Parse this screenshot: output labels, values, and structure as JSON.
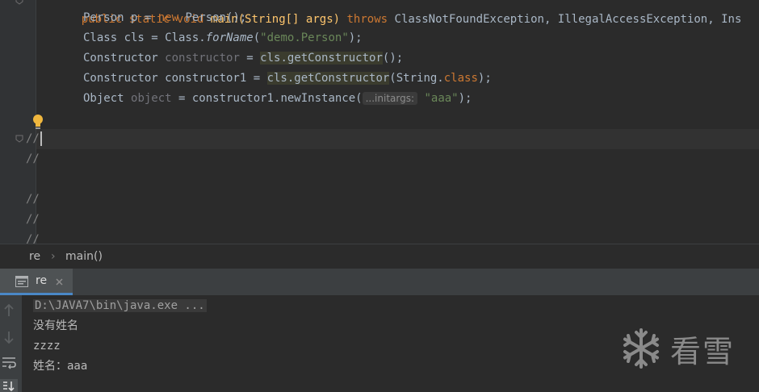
{
  "editor": {
    "header_line": {
      "mod1": "public",
      "mod2": "static",
      "mod3": "void",
      "method": "main(String[] args)",
      "throws_kw": "throws",
      "exceptions": "ClassNotFoundException, IllegalAccessException, Ins"
    },
    "line1": {
      "type": "Person p = ",
      "new": "new",
      "rest": " Person();"
    },
    "line2": {
      "a": "Class cls = Class.",
      "method": "forName",
      "open": "(",
      "str": "\"demo.Person\"",
      "close": ");"
    },
    "line3": {
      "type": "Constructor ",
      "var": "constructor",
      "eq": " = ",
      "call": "cls.getConstructor",
      "end": "();"
    },
    "line4": {
      "type": "Constructor constructor1 = ",
      "call": "cls.getConstructor",
      "arg": "(String.",
      "kw": "class",
      "end": ");"
    },
    "line5": {
      "type": "Object ",
      "var": "object",
      "rest": " = constructor1.newInstance(",
      "hint": "...initargs:",
      "str": "\"aaa\"",
      "end": ");"
    },
    "comments": [
      "//",
      "//",
      "//",
      "//",
      "//"
    ]
  },
  "breadcrumb": {
    "file": "re",
    "separator": "›",
    "method": "main()"
  },
  "run_panel": {
    "tab_label": "re",
    "console_lines": [
      "D:\\JAVA7\\bin\\java.exe ...",
      "没有姓名",
      "zzzz",
      "姓名：aaa"
    ]
  },
  "watermark": {
    "text": "看雪",
    "icon": "snowflake-icon"
  },
  "colors": {
    "editor_bg": "#2b2b2b",
    "keyword": "#cc7832",
    "string": "#6a8759",
    "text": "#a9b7c6",
    "unused": "#72737a",
    "accent": "#4a88c7"
  }
}
